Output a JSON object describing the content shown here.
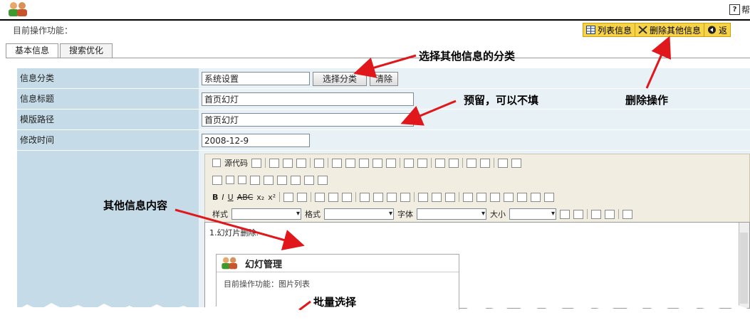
{
  "header": {
    "help_label": "帮"
  },
  "op_line": "目前操作功能：",
  "actions": [
    {
      "icon": "table-icon",
      "label": "列表信息"
    },
    {
      "icon": "scissors-icon",
      "label": "删除其他信息"
    },
    {
      "icon": "back-icon",
      "label": "返"
    }
  ],
  "tabs": [
    {
      "label": "基本信息",
      "active": true
    },
    {
      "label": "搜索优化",
      "active": false
    }
  ],
  "form": {
    "category": {
      "label": "信息分类",
      "value": "系统设置",
      "select_button": "选择分类",
      "clear_button": "清除"
    },
    "title": {
      "label": "信息标题",
      "value": "首页幻灯"
    },
    "template": {
      "label": "模版路径",
      "value": "首页幻灯"
    },
    "modified": {
      "label": "修改时间",
      "value": "2008-12-9"
    }
  },
  "editor": {
    "source_label": "源代码",
    "style_label": "样式",
    "format_label": "格式",
    "font_label": "字体",
    "size_label": "大小",
    "content_text": "1.幻灯片删除.",
    "inner_title": "幻灯管理",
    "inner_op": "目前操作功能：图片列表"
  },
  "annotations": {
    "select_category": "选择其他信息的分类",
    "reserved": "预留，可以不填",
    "delete_op": "删除操作",
    "other_content": "其他信息内容",
    "batch_select": "批量选择"
  }
}
